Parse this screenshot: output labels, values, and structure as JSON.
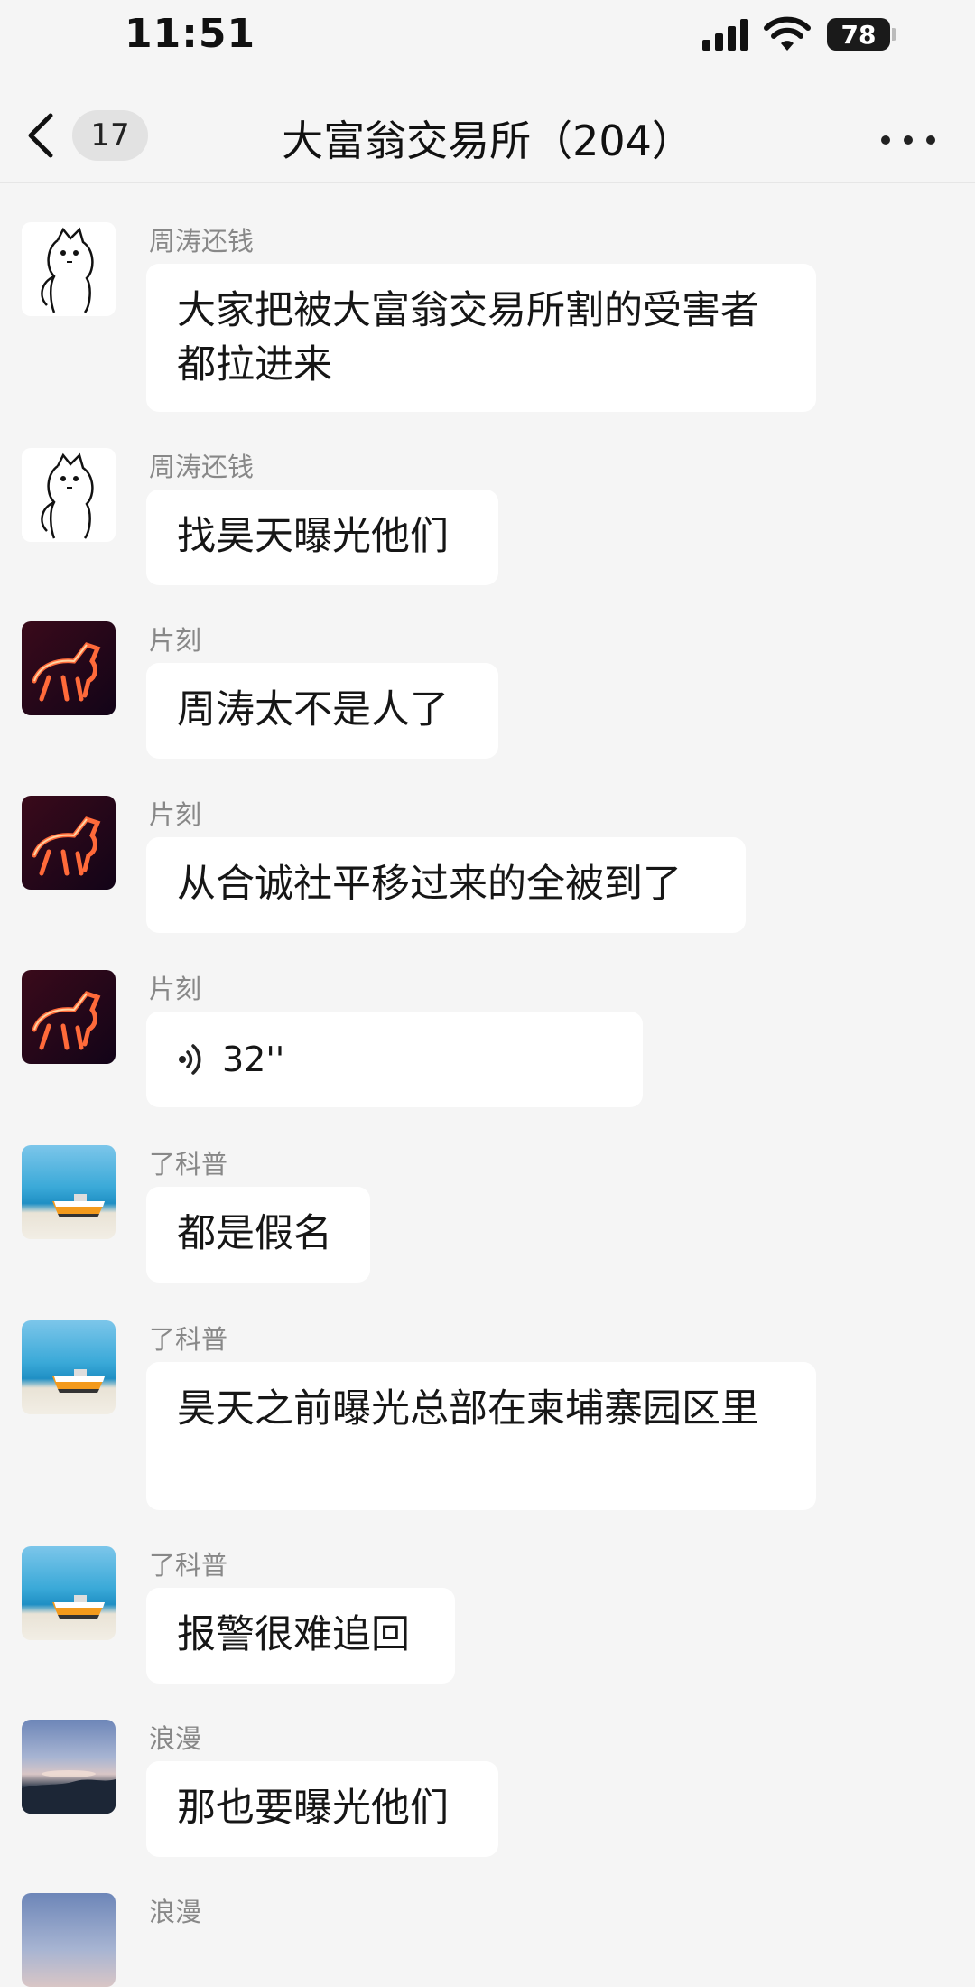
{
  "status_bar": {
    "time": "11:51",
    "battery": "78"
  },
  "nav": {
    "unread_count": "17",
    "title": "大富翁交易所（204）"
  },
  "messages": [
    {
      "sender": "周涛还钱",
      "avatar": "cat-sketch",
      "text": "大家把被大富翁交易所割的受害者都拉进来"
    },
    {
      "sender": "周涛还钱",
      "avatar": "cat-sketch",
      "text": "找昊天曝光他们"
    },
    {
      "sender": "片刻",
      "avatar": "fire-horse",
      "text": "周涛太不是人了"
    },
    {
      "sender": "片刻",
      "avatar": "fire-horse",
      "text": "从合诚社平移过来的全被到了"
    },
    {
      "sender": "片刻",
      "avatar": "fire-horse",
      "voice_duration": "32''"
    },
    {
      "sender": "了科普",
      "avatar": "beach-boat",
      "text": "都是假名"
    },
    {
      "sender": "了科普",
      "avatar": "beach-boat",
      "text": "昊天之前曝光总部在柬埔寨园区里"
    },
    {
      "sender": "了科普",
      "avatar": "beach-boat",
      "text": "报警很难追回"
    },
    {
      "sender": "浪漫",
      "avatar": "sunset-sky",
      "text": "那也要曝光他们"
    },
    {
      "sender": "浪漫",
      "avatar": "sunset-sky"
    }
  ]
}
